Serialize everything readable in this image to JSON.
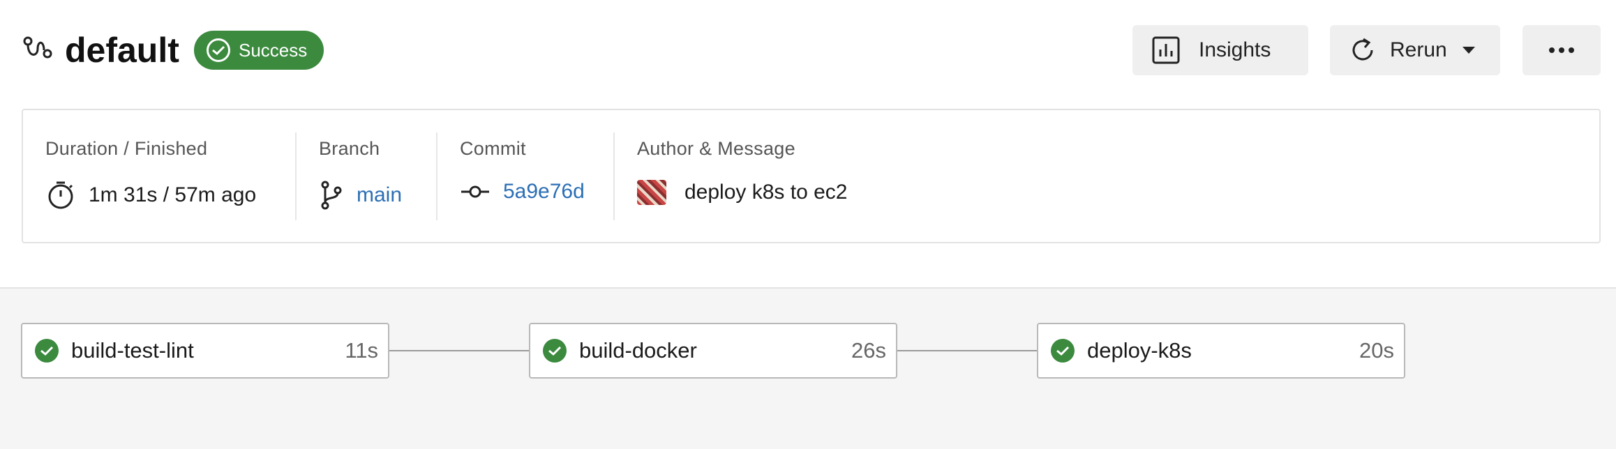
{
  "header": {
    "title": "default",
    "status": "Success",
    "insights_label": "Insights",
    "rerun_label": "Rerun",
    "more_label": "•••",
    "icons": {
      "workflow": "workflow-icon",
      "status": "check-circle-icon",
      "insights": "bar-chart-icon",
      "rerun": "refresh-icon",
      "rerun_menu": "caret-down-icon",
      "more": "ellipsis-icon"
    }
  },
  "details": {
    "duration_label": "Duration / Finished",
    "duration_value": "1m 31s / 57m ago",
    "branch_label": "Branch",
    "branch_value": "main",
    "commit_label": "Commit",
    "commit_value": "5a9e76d",
    "author_label": "Author & Message",
    "message_value": "deploy k8s to ec2"
  },
  "jobs": [
    {
      "name": "build-test-lint",
      "duration": "11s",
      "status": "success"
    },
    {
      "name": "build-docker",
      "duration": "26s",
      "status": "success"
    },
    {
      "name": "deploy-k8s",
      "duration": "20s",
      "status": "success"
    }
  ],
  "colors": {
    "success": "#3b8a3e",
    "link": "#2b6fb5",
    "button_bg": "#efefef",
    "graph_bg": "#f5f5f5"
  }
}
